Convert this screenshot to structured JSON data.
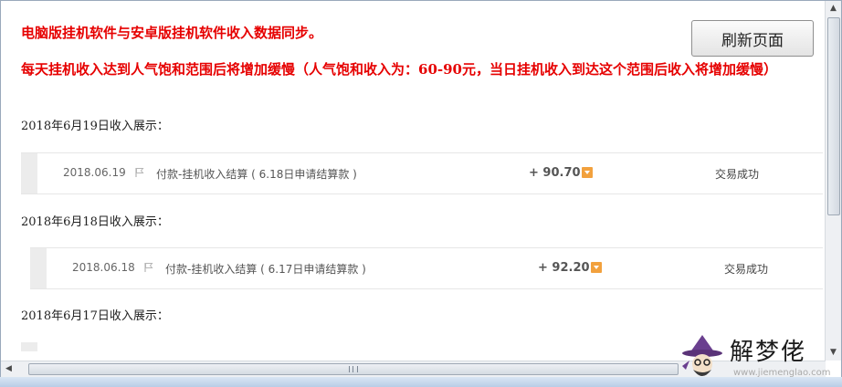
{
  "headline_1": "电脑版挂机软件与安卓版挂机软件收入数据同步。",
  "headline_2": "每天挂机收入达到人气饱和范围后将增加缓慢（人气饱和收入为：60-90元，当日挂机收入到达这个范围后收入将增加缓慢）",
  "refresh_button": "刷新页面",
  "sections": [
    {
      "label": "2018年6月19日收入展示：",
      "row": {
        "date": "2018.06.19",
        "description": "付款-挂机收入结算 ( 6.18日申请结算款 )",
        "amount": "+ 90.70",
        "status": "交易成功"
      }
    },
    {
      "label": "2018年6月18日收入展示：",
      "row": {
        "date": "2018.06.18",
        "description": "付款-挂机收入结算 ( 6.17日申请结算款 )",
        "amount": "+ 92.20",
        "status": "交易成功"
      }
    },
    {
      "label": "2018年6月17日收入展示："
    }
  ],
  "watermark": {
    "text": "解梦佬",
    "url": "www.jiemenglao.com"
  },
  "icons": {
    "flag": "flag-icon",
    "expand": "expand-icon",
    "logo": "wizard-logo-icon"
  },
  "colors": {
    "headline": "#e60000",
    "expand_icon": "#f2a13d"
  }
}
